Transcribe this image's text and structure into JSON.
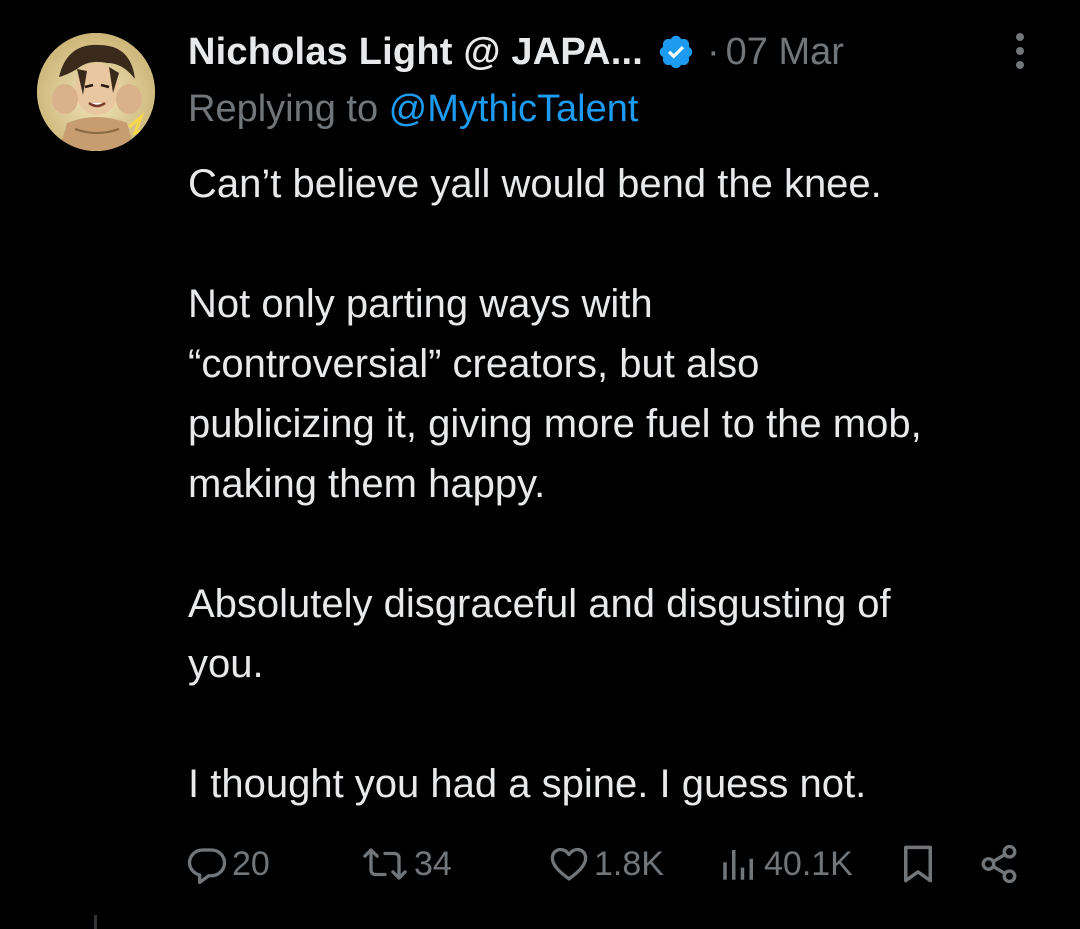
{
  "tweet": {
    "author_name": "Nicholas Light @ JAPA...",
    "separator": "·",
    "date": "07 Mar",
    "replying_prefix": "Replying to ",
    "replying_handle": "@MythicTalent",
    "paragraphs": [
      [
        "Can’t believe yall would bend the knee."
      ],
      [
        "Not only parting ways with",
        "“controversial” creators, but also",
        "publicizing it, giving more fuel to the mob,",
        "making them happy."
      ],
      [
        "Absolutely disgraceful and disgusting of",
        "you."
      ],
      [
        "I thought you had a spine. I guess not."
      ]
    ]
  },
  "actions": {
    "reply_count": "20",
    "retweet_count": "34",
    "like_count": "1.8K",
    "views_count": "40.1K"
  },
  "icons": {
    "verified": "verified-badge-icon",
    "more": "more-vertical-icon",
    "reply": "reply-icon",
    "retweet": "retweet-icon",
    "like": "heart-icon",
    "views": "views-icon",
    "bookmark": "bookmark-icon",
    "share": "share-icon"
  },
  "colors": {
    "background": "#000000",
    "text": "#e7e9ea",
    "muted": "#71767b",
    "accent": "#1d9bf0"
  }
}
